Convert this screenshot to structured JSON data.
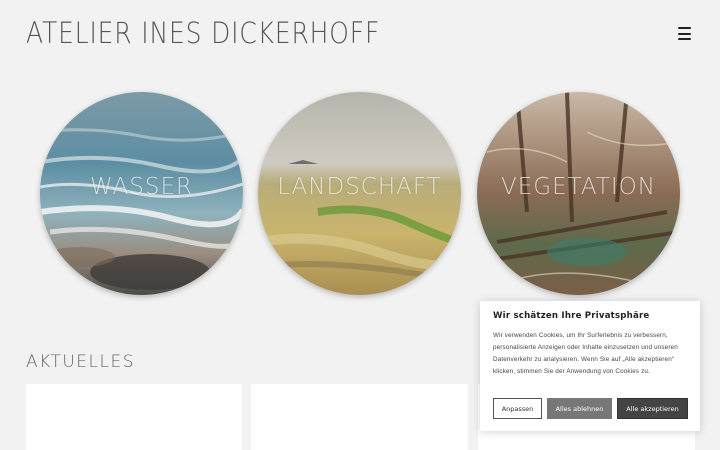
{
  "header": {
    "site_title": "ATELIER INES DICKERHOFF",
    "menu_icon": "hamburger-menu-icon"
  },
  "categories": [
    {
      "label": "WASSER"
    },
    {
      "label": "LANDSCHAFT"
    },
    {
      "label": "VEGETATION"
    }
  ],
  "news": {
    "heading": "AKTUELLES"
  },
  "cookie_banner": {
    "title": "Wir schätzen Ihre Privatsphäre",
    "text": "Wir verwenden Cookies, um Ihr Surferlebnis zu verbessern, personalisierte Anzeigen oder Inhalte einzusetzen und unseren Datenverkehr zu analysieren. Wenn Sie auf „Alle akzeptieren“ klicken, stimmen Sie der Anwendung von Cookies zu.",
    "customize_label": "Anpassen",
    "reject_label": "Alles ablehnen",
    "accept_label": "Alle akzeptieren"
  },
  "colors": {
    "background": "#f1f2f1",
    "accept_button": "#444444",
    "reject_button": "#777777"
  }
}
